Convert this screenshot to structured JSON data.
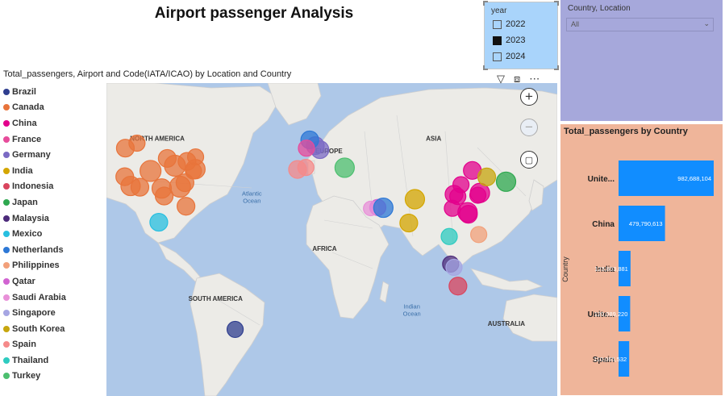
{
  "report": {
    "title": "Airport passenger Analysis"
  },
  "year_slicer": {
    "header": "year",
    "options": [
      {
        "label": "2022",
        "checked": false
      },
      {
        "label": "2023",
        "checked": true
      },
      {
        "label": "2024",
        "checked": false
      }
    ]
  },
  "country_slicer": {
    "header": "Country, Location",
    "value": "All"
  },
  "map_visual": {
    "title": "Total_passengers, Airport and Code(IATA/ICAO) by Location and Country",
    "continent_labels": [
      "NORTH AMERICA",
      "EUROPE",
      "ASIA",
      "AFRICA",
      "SOUTH AMERICA",
      "AUSTRALIA"
    ],
    "ocean_labels": [
      [
        "Atlantic",
        "Ocean"
      ],
      [
        "Indian",
        "Ocean"
      ]
    ],
    "legend": [
      {
        "name": "Brazil",
        "color": "#2f3e8f"
      },
      {
        "name": "Canada",
        "color": "#e8743b"
      },
      {
        "name": "China",
        "color": "#e3008c"
      },
      {
        "name": "France",
        "color": "#e74c9b"
      },
      {
        "name": "Germany",
        "color": "#7b6ac4"
      },
      {
        "name": "India",
        "color": "#d4a600"
      },
      {
        "name": "Indonesia",
        "color": "#d9455e"
      },
      {
        "name": "Japan",
        "color": "#2ea84f"
      },
      {
        "name": "Malaysia",
        "color": "#4c2a7a"
      },
      {
        "name": "Mexico",
        "color": "#27bfe0"
      },
      {
        "name": "Netherlands",
        "color": "#2d78d6"
      },
      {
        "name": "Philippines",
        "color": "#f2a07a"
      },
      {
        "name": "Qatar",
        "color": "#d163d1"
      },
      {
        "name": "Saudi Arabia",
        "color": "#e890d8"
      },
      {
        "name": "Singapore",
        "color": "#a6a6e3"
      },
      {
        "name": "South Korea",
        "color": "#c7a60e"
      },
      {
        "name": "Spain",
        "color": "#f58a8a"
      },
      {
        "name": "Thailand",
        "color": "#2ecbc0"
      },
      {
        "name": "Turkey",
        "color": "#4cbf6f"
      }
    ],
    "bubbles": [
      {
        "country": "Brazil",
        "lon": -46.5,
        "lat": -23.4,
        "size": 10
      },
      {
        "country": "Canada",
        "lon": -122,
        "lat": 49,
        "size": 11
      },
      {
        "country": "Canada",
        "lon": -114,
        "lat": 51,
        "size": 10
      },
      {
        "country": "Canada",
        "lon": -79.6,
        "lat": 43.7,
        "size": 11
      },
      {
        "country": "Canada",
        "lon": -73.7,
        "lat": 45.5,
        "size": 10
      },
      {
        "country": "Canada",
        "lon": -118.4,
        "lat": 33.9,
        "size": 12
      },
      {
        "country": "Canada",
        "lon": -122.4,
        "lat": 37.6,
        "size": 11
      },
      {
        "country": "Canada",
        "lon": -112,
        "lat": 33.4,
        "size": 11
      },
      {
        "country": "Canada",
        "lon": -104.7,
        "lat": 39.9,
        "size": 13
      },
      {
        "country": "Canada",
        "lon": -97,
        "lat": 32.9,
        "size": 12
      },
      {
        "country": "Canada",
        "lon": -95.3,
        "lat": 29.9,
        "size": 11
      },
      {
        "country": "Canada",
        "lon": -87.9,
        "lat": 41.98,
        "size": 13
      },
      {
        "country": "Canada",
        "lon": -84.4,
        "lat": 33.6,
        "size": 13
      },
      {
        "country": "Canada",
        "lon": -80.3,
        "lat": 25.8,
        "size": 11
      },
      {
        "country": "Canada",
        "lon": -73.8,
        "lat": 40.6,
        "size": 12
      },
      {
        "country": "Canada",
        "lon": -75.2,
        "lat": 39.9,
        "size": 10
      },
      {
        "country": "Canada",
        "lon": -81,
        "lat": 35.2,
        "size": 11
      },
      {
        "country": "Canada",
        "lon": -93.2,
        "lat": 44.9,
        "size": 11
      },
      {
        "country": "Mexico",
        "lon": -99,
        "lat": 19.4,
        "size": 11
      },
      {
        "country": "Germany",
        "lon": 8.6,
        "lat": 50,
        "size": 11
      },
      {
        "country": "Germany",
        "lon": 11.8,
        "lat": 48.4,
        "size": 11
      },
      {
        "country": "Netherlands",
        "lon": 4.8,
        "lat": 52.3,
        "size": 11
      },
      {
        "country": "France",
        "lon": 2.5,
        "lat": 49,
        "size": 10
      },
      {
        "country": "Spain",
        "lon": -3.6,
        "lat": 40.5,
        "size": 11
      },
      {
        "country": "Spain",
        "lon": 2.1,
        "lat": 41.3,
        "size": 10
      },
      {
        "country": "Turkey",
        "lon": 28.8,
        "lat": 41.2,
        "size": 12
      },
      {
        "country": "Qatar",
        "lon": 51.6,
        "lat": 25.3,
        "size": 10
      },
      {
        "country": "Saudi Arabia",
        "lon": 46.7,
        "lat": 24.9,
        "size": 9
      },
      {
        "country": "Netherlands",
        "lon": 55.4,
        "lat": 25.2,
        "size": 12
      },
      {
        "country": "India",
        "lon": 77.1,
        "lat": 28.6,
        "size": 12
      },
      {
        "country": "India",
        "lon": 72.9,
        "lat": 19.1,
        "size": 11
      },
      {
        "country": "Thailand",
        "lon": 100.7,
        "lat": 13.7,
        "size": 10
      },
      {
        "country": "Malaysia",
        "lon": 101.7,
        "lat": 2.7,
        "size": 10
      },
      {
        "country": "Singapore",
        "lon": 104,
        "lat": 1.4,
        "size": 10
      },
      {
        "country": "Indonesia",
        "lon": 106.7,
        "lat": -6.1,
        "size": 11
      },
      {
        "country": "Philippines",
        "lon": 121,
        "lat": 14.5,
        "size": 10
      },
      {
        "country": "China",
        "lon": 113.3,
        "lat": 23.4,
        "size": 12
      },
      {
        "country": "China",
        "lon": 113.9,
        "lat": 22.6,
        "size": 11
      },
      {
        "country": "China",
        "lon": 121.8,
        "lat": 31.1,
        "size": 12
      },
      {
        "country": "China",
        "lon": 116.6,
        "lat": 40.1,
        "size": 11
      },
      {
        "country": "China",
        "lon": 104,
        "lat": 30.6,
        "size": 11
      },
      {
        "country": "China",
        "lon": 108.8,
        "lat": 34.4,
        "size": 10
      },
      {
        "country": "China",
        "lon": 106.6,
        "lat": 29.7,
        "size": 10
      },
      {
        "country": "China",
        "lon": 102.9,
        "lat": 25,
        "size": 10
      },
      {
        "country": "China",
        "lon": 120.4,
        "lat": 30.2,
        "size": 10
      },
      {
        "country": "South Korea",
        "lon": 126.5,
        "lat": 37.5,
        "size": 11
      },
      {
        "country": "Japan",
        "lon": 139.8,
        "lat": 35.6,
        "size": 12
      }
    ]
  },
  "bar_chart": {
    "title": "Total_passengers by Country",
    "y_axis_label": "Country",
    "bar_color": "#118dff",
    "categories": [
      "Unite...",
      "China",
      "India",
      "Unite...",
      "Spain"
    ],
    "values": [
      982688104,
      479790613,
      123803881,
      120089220,
      110065532
    ],
    "value_labels": [
      "982,688,104",
      "479,790,613",
      "123,803,881",
      "120,089,220",
      "110,065,532"
    ]
  }
}
